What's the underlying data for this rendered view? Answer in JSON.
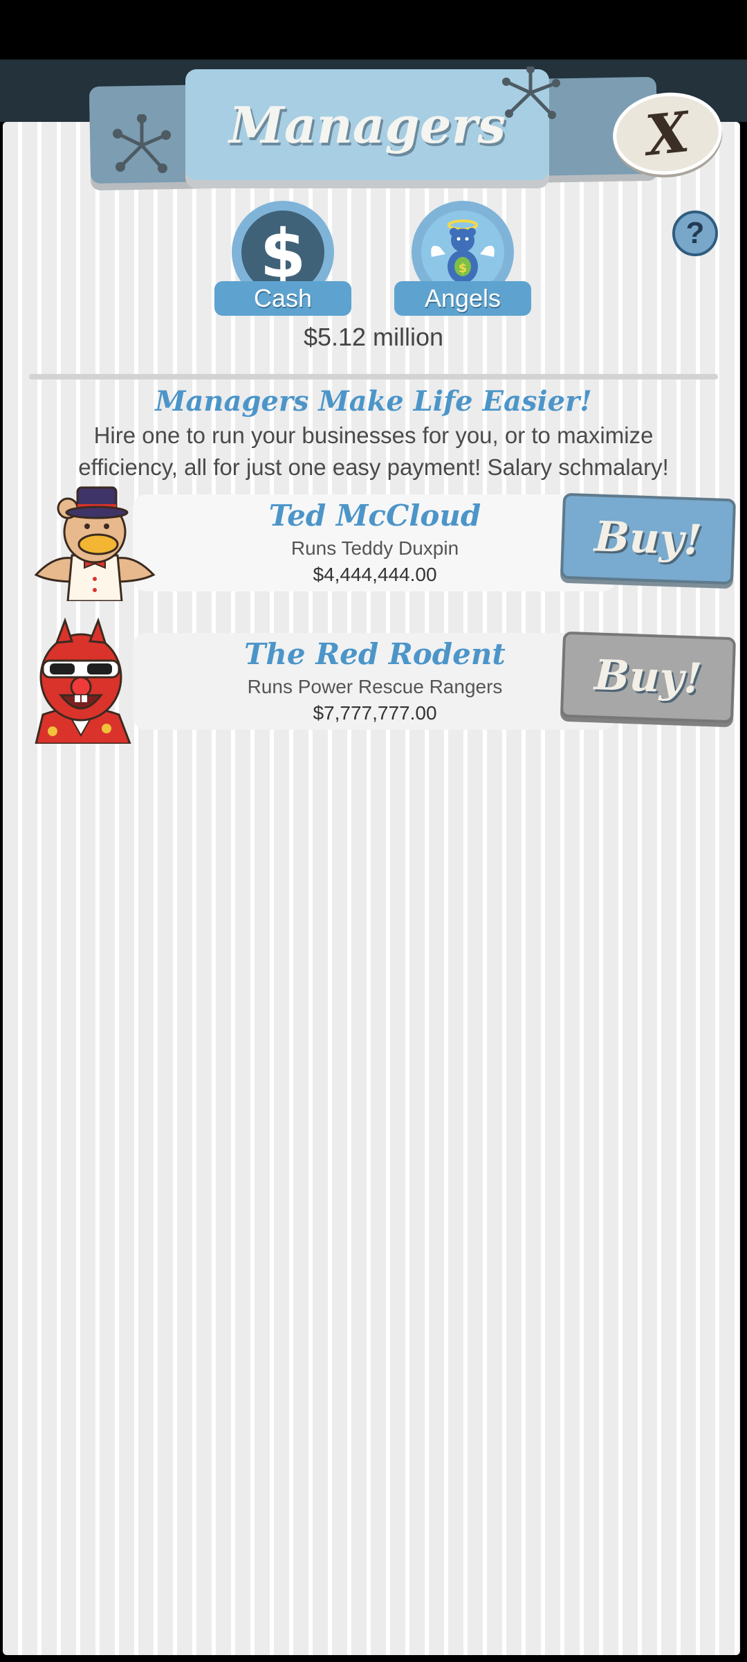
{
  "header": {
    "title": "Managers",
    "close_label": "X",
    "help_label": "?"
  },
  "currency_tabs": [
    {
      "label": "Cash",
      "icon": "dollar-icon"
    },
    {
      "label": "Angels",
      "icon": "angel-bear-icon"
    }
  ],
  "balance": "$5.12 million",
  "promo": {
    "title": "Managers Make Life Easier!",
    "body": "Hire one to run your businesses for you, or to maximize efficiency, all for just one easy payment! Salary schmalary!"
  },
  "managers": [
    {
      "name": "Ted McCloud",
      "runs": "Runs Teddy Duxpin",
      "price": "$4,444,444.00",
      "buy_label": "Buy!",
      "affordable": true
    },
    {
      "name": "The Red Rodent",
      "runs": "Runs Power Rescue Rangers",
      "price": "$7,777,777.00",
      "buy_label": "Buy!",
      "affordable": false
    }
  ],
  "colors": {
    "accent_blue": "#4c95c9",
    "buy_active": "#79aacf",
    "buy_disabled": "#a7a7a7"
  }
}
